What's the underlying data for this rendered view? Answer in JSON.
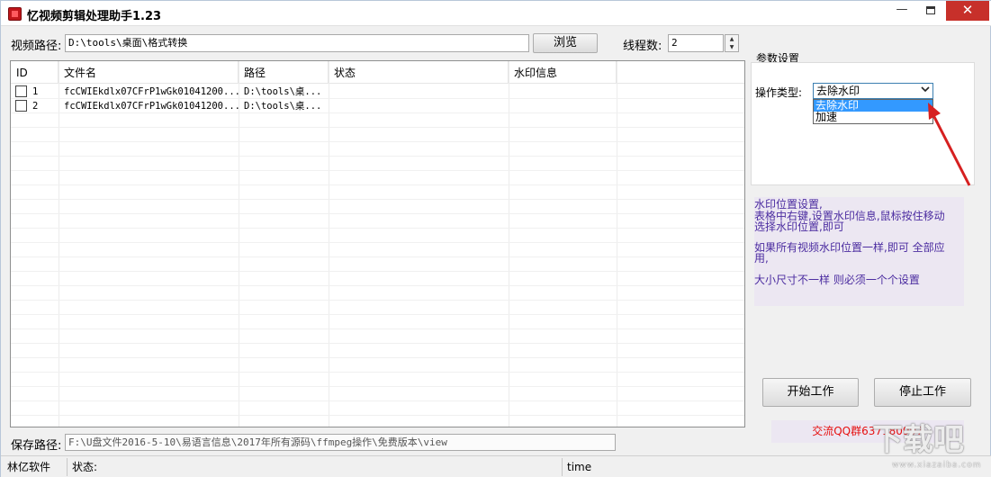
{
  "window": {
    "title": "忆视频剪辑处理助手1.23",
    "minimize_glyph": "—",
    "close_glyph": "✕"
  },
  "toolbar": {
    "video_path_label": "视频路径:",
    "video_path_value": "D:\\tools\\桌面\\格式转换",
    "browse_label": "浏览",
    "threads_label": "线程数:",
    "threads_value": "2",
    "spin_up": "▲",
    "spin_down": "▼"
  },
  "table": {
    "columns": [
      "ID",
      "文件名",
      "路径",
      "状态",
      "水印信息"
    ],
    "rows": [
      {
        "id": "1",
        "filename": "fcCWIEkdlx07CFrP1wGk01041200...",
        "path": "D:\\tools\\桌...",
        "status": "",
        "watermark": ""
      },
      {
        "id": "2",
        "filename": "fcCWIEkdlx07CFrP1wGk01041200...",
        "path": "D:\\tools\\桌...",
        "status": "",
        "watermark": ""
      }
    ]
  },
  "params": {
    "group_label": "参数设置",
    "op_type_label": "操作类型:",
    "op_type_value": "去除水印",
    "options": [
      "去除水印",
      "加速"
    ],
    "selected_index": 0
  },
  "info": {
    "line1": "水印位置设置,",
    "line2": "表格中右键,设置水印信息,鼠标按住移动",
    "line3": "选择水印位置,即可",
    "line4": "如果所有视频水印位置一样,即可 全部应",
    "line5": "用,",
    "line6": "大小尺寸不一样 则必须一个个设置"
  },
  "actions": {
    "start_label": "开始工作",
    "stop_label": "停止工作"
  },
  "qq_text": "交流QQ群637180997",
  "save": {
    "label": "保存路径:",
    "value": "F:\\U盘文件2016-5-10\\易语言信息\\2017年所有源码\\ffmpeg操作\\免费版本\\view"
  },
  "statusbar": {
    "company": "林亿软件",
    "status_label": "状态:",
    "time_label": "time"
  },
  "watermark_logo": {
    "text": "下载吧",
    "url": "www.xiazaiba.com"
  },
  "colors": {
    "close_button": "#c7302a",
    "info_text": "#4b2ca0",
    "qq_text": "#e60f0f",
    "selection": "#3399ff",
    "annotation_arrow": "#d62020"
  }
}
